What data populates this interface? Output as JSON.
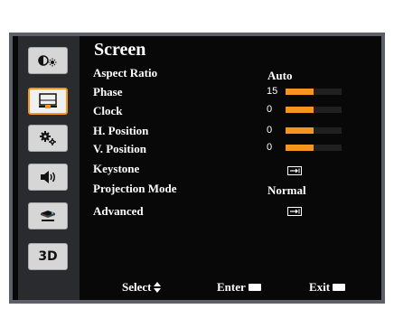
{
  "menu": {
    "title": "Screen",
    "categories": [
      {
        "icon": "picture-icon"
      },
      {
        "icon": "screen-icon",
        "selected": true
      },
      {
        "icon": "settings-icon"
      },
      {
        "icon": "volume-icon"
      },
      {
        "icon": "options-icon"
      },
      {
        "icon": "3d-icon",
        "label": "3D"
      }
    ],
    "items": [
      {
        "label": "Aspect Ratio",
        "value": "Auto"
      },
      {
        "label": "Phase",
        "value": "15",
        "level": 0.5
      },
      {
        "label": "Clock",
        "value": "0",
        "level": 0.5
      },
      {
        "label": "H. Position",
        "value": "0",
        "level": 0.5
      },
      {
        "label": "V. Position",
        "value": "0",
        "level": 0.5
      },
      {
        "label": "Keystone",
        "value_icon": "enter-icon"
      },
      {
        "label": "Projection Mode",
        "value": "Normal"
      },
      {
        "label": "Advanced",
        "value_icon": "enter-icon"
      }
    ]
  },
  "footer": {
    "select_label": "Select",
    "select_icon": "up-down-arrows-icon",
    "enter_label": "Enter",
    "enter_icon": "enter-key-icon",
    "exit_label": "Exit",
    "exit_icon": "menu-key-icon"
  },
  "colors": {
    "accent": "#f7941d",
    "background": "#080808",
    "sidebar": "#2a2b2e",
    "frame": "#5d6068",
    "text": "#ffffff"
  }
}
